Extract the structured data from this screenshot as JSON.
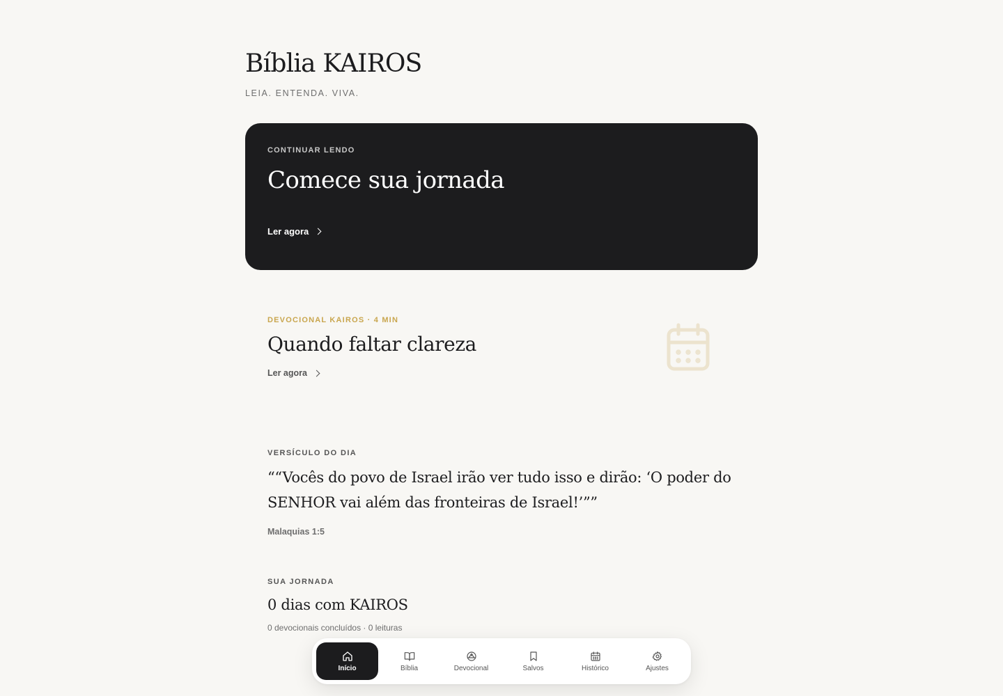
{
  "header": {
    "title": "Bíblia KAIROS",
    "tagline": "LEIA. ENTENDA. VIVA."
  },
  "hero": {
    "eyebrow": "CONTINUAR LENDO",
    "title": "Comece sua jornada",
    "cta": "Ler agora"
  },
  "devotional": {
    "eyebrow": "DEVOCIONAL KAIROS · 4 MIN",
    "title": "Quando faltar clareza",
    "cta": "Ler agora",
    "icon": "calendar-icon"
  },
  "verse": {
    "eyebrow": "VERSÍCULO DO DIA",
    "text": "““Vocês do povo de Israel irão ver tudo isso e dirão: ‘O poder do SENHOR vai além das fronteiras de Israel!’””",
    "reference": "Malaquias 1:5"
  },
  "journey": {
    "eyebrow": "SUA JORNADA",
    "title": "0 dias com KAIROS",
    "stats": "0 devocionais concluídos · 0 leituras"
  },
  "nav": {
    "items": [
      {
        "label": "Início",
        "icon": "home-icon",
        "active": true
      },
      {
        "label": "Bíblia",
        "icon": "book-open-icon",
        "active": false
      },
      {
        "label": "Devocional",
        "icon": "sunrise-icon",
        "active": false
      },
      {
        "label": "Salvos",
        "icon": "bookmark-icon",
        "active": false
      },
      {
        "label": "Histórico",
        "icon": "calendar-icon",
        "active": false
      },
      {
        "label": "Ajustes",
        "icon": "gear-icon",
        "active": false
      }
    ]
  },
  "colors": {
    "background": "#f8f7f4",
    "hero_background": "#1c1c1e",
    "accent_gold": "#c9a64e",
    "text_primary": "#1c1c1e",
    "text_muted": "#6e6e6e"
  }
}
